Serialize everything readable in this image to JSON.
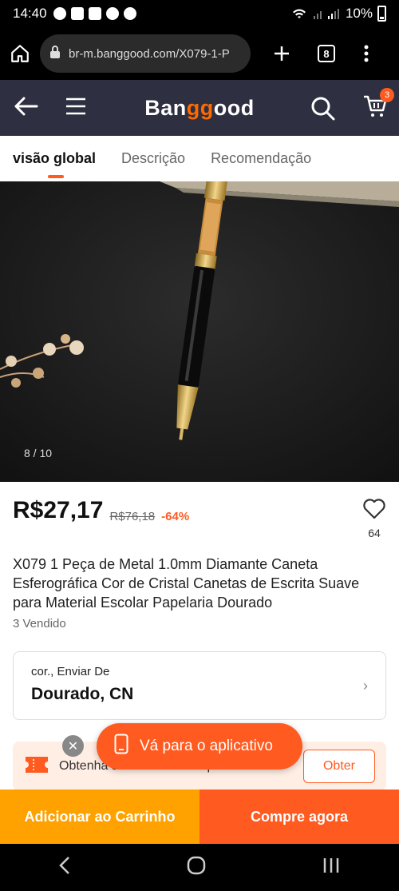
{
  "status_bar": {
    "time": "14:40",
    "battery": "10%"
  },
  "browser": {
    "url": "br-m.banggood.com/X079-1-P",
    "tab_count": "8"
  },
  "header": {
    "logo_prefix": "Ban",
    "logo_highlight": "gg",
    "logo_suffix": "ood",
    "cart_count": "3"
  },
  "tabs": [
    {
      "label": "visão global"
    },
    {
      "label": "Descrição"
    },
    {
      "label": "Recomendação"
    }
  ],
  "gallery": {
    "counter": "8 / 10"
  },
  "product": {
    "price": "R$27,17",
    "old_price": "R$76,18",
    "discount": "-64%",
    "wishlist_count": "64",
    "title": "X079 1 Peça de Metal 1.0mm Diamante Caneta Esferográfica Cor de Cristal Canetas de Escrita Suave para Material Escolar Papelaria  Dourado",
    "sold": "3 Vendido"
  },
  "option": {
    "label": "cor.,  Enviar De",
    "value": "Dourado, CN"
  },
  "coupon": {
    "text": "Obtenha seu 2º bônus do pedido",
    "button": "Obter"
  },
  "app_banner": {
    "label": "Vá para o aplicativo"
  },
  "actions": {
    "add_to_cart": "Adicionar ao Carrinho",
    "buy_now": "Compre agora"
  }
}
